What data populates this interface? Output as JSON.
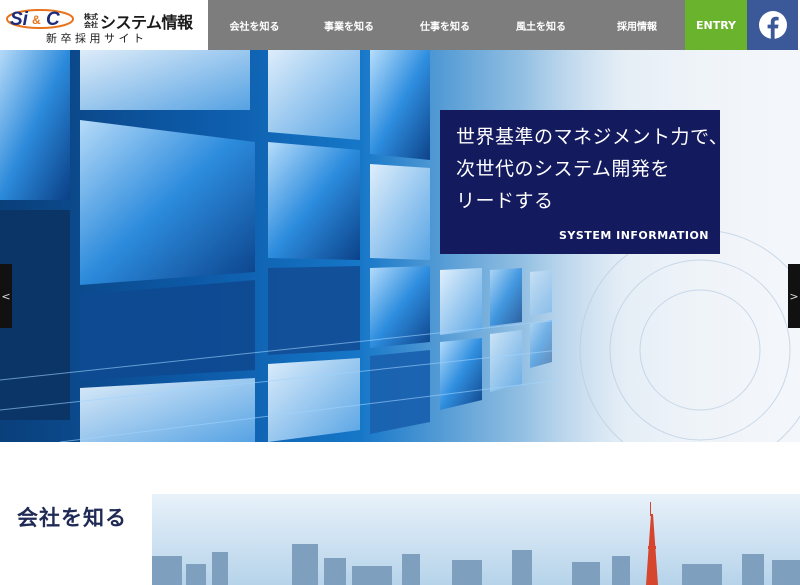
{
  "header": {
    "logo": {
      "mark_text": "SI&C",
      "kabushiki_top": "株式",
      "kabushiki_bottom": "会社",
      "company_name": "システム情報",
      "subtitle": "新卒採用サイト"
    },
    "nav": [
      {
        "label": "会社を知る"
      },
      {
        "label": "事業を知る"
      },
      {
        "label": "仕事を知る"
      },
      {
        "label": "風土を知る"
      },
      {
        "label": "採用情報"
      }
    ],
    "entry_label": "ENTRY",
    "facebook_icon": "facebook-f"
  },
  "hero": {
    "lines": [
      "世界基準のマネジメント力で、",
      "次世代のシステム開発を",
      "リードする"
    ],
    "brand": "SYSTEM INFORMATION",
    "prev_label": "<",
    "next_label": ">"
  },
  "section": {
    "title": "会社を知る"
  },
  "colors": {
    "nav_bg": "#7d7d7d",
    "entry_bg": "#6ab42d",
    "facebook_bg": "#3b5998",
    "hero_box_bg": "#141a5e",
    "section_title": "#1f2a55"
  }
}
